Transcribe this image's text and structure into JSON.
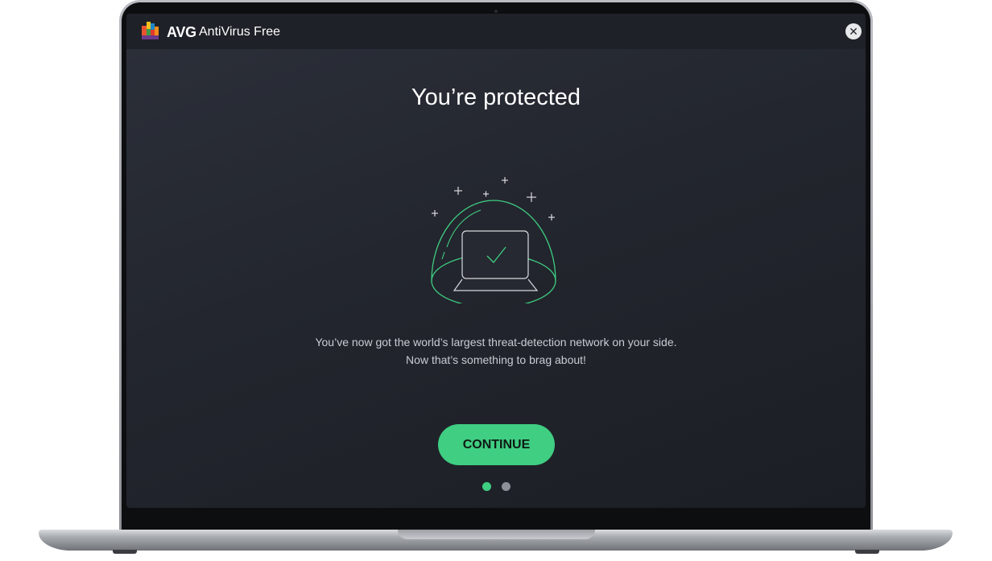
{
  "window": {
    "brand": "AVG",
    "app_name": "AntiVirus Free",
    "close_label": "✕"
  },
  "main": {
    "headline": "You’re protected",
    "description_line1": "You’ve now got the world’s largest threat-detection network on your side.",
    "description_line2": "Now that’s something to brag about!",
    "continue_label": "CONTINUE"
  },
  "pager": {
    "total_pages": 2,
    "current_page": 1
  },
  "colors": {
    "accent": "#3fce82",
    "screen_bg": "#23262e",
    "titlebar_bg": "#1f2128",
    "dot_inactive": "#8d9098"
  },
  "icons": {
    "logo": "avg-logo-icon",
    "close": "close-icon",
    "illustration": "protected-laptop-dome-icon"
  }
}
